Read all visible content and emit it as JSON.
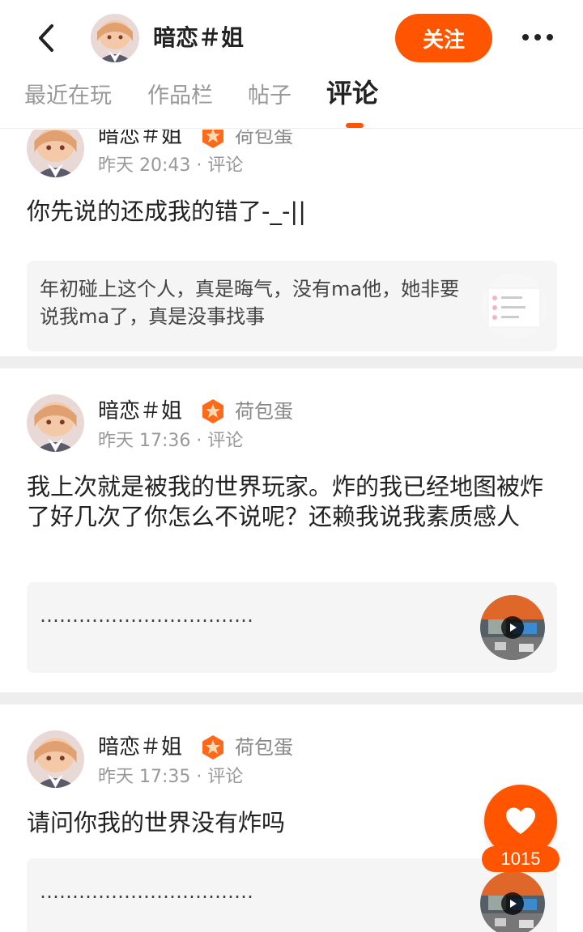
{
  "header": {
    "username": "暗恋＃姐",
    "follow_label": "关注",
    "icons": {
      "back": "chevron-left-icon",
      "more": "more-dots-icon"
    }
  },
  "tabs": [
    {
      "label": "最近在玩"
    },
    {
      "label": "作品栏"
    },
    {
      "label": "帖子"
    },
    {
      "label": "评论",
      "active": true
    }
  ],
  "colors": {
    "accent": "#ff5500",
    "divider": "#eeeeee",
    "quote_bg": "#f5f5f5"
  },
  "posts": [
    {
      "author": "暗恋＃姐",
      "badge": "荷包蛋",
      "meta": "昨天 20:43 · 评论",
      "text": "你先说的还成我的错了-_-||",
      "quote": "年初碰上这个人，真是晦气，没有ma他，她非要说我ma了，真是没事找事",
      "quote_media": "image-thumbnail"
    },
    {
      "author": "暗恋＃姐",
      "badge": "荷包蛋",
      "meta": "昨天 17:36 · 评论",
      "text": "我上次就是被我的世界玩家。炸的我已经地图被炸了好几次了你怎么不说呢？还赖我说我素质感人",
      "quote": "……………………………",
      "quote_media": "video-thumbnail"
    },
    {
      "author": "暗恋＃姐",
      "badge": "荷包蛋",
      "meta": "昨天 17:35 · 评论",
      "text": "请问你我的世界没有炸吗",
      "quote": "……………………………",
      "quote_media": "video-thumbnail"
    }
  ],
  "like_button": {
    "count": "1015",
    "icon": "heart-icon"
  }
}
